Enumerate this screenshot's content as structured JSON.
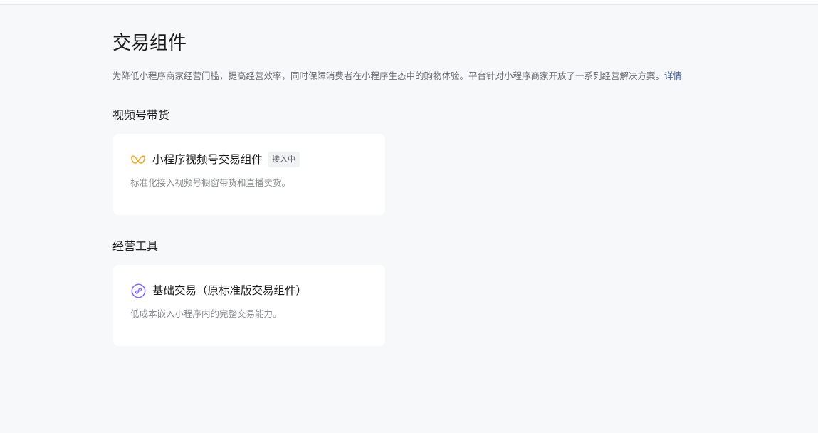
{
  "page": {
    "title": "交易组件",
    "description": "为降低小程序商家经营门槛，提高经营效率，同时保障消费者在小程序生态中的购物体验。平台针对小程序商家开放了一系列经营解决方案。",
    "details_link": "详情"
  },
  "sections": [
    {
      "title": "视频号带货",
      "card": {
        "icon": "channels-icon",
        "title": "小程序视频号交易组件",
        "badge": "接入中",
        "description": "标准化接入视频号橱窗带货和直播卖货。"
      }
    },
    {
      "title": "经营工具",
      "card": {
        "icon": "mini-program-icon",
        "title": "基础交易（原标准版交易组件）",
        "description": "低成本嵌入小程序内的完整交易能力。"
      }
    }
  ],
  "colors": {
    "background": "#f7f8fa",
    "card": "#ffffff",
    "link": "#3f5e99",
    "channels_icon": "#f5a623",
    "mini_program_icon": "#7b61ff"
  }
}
